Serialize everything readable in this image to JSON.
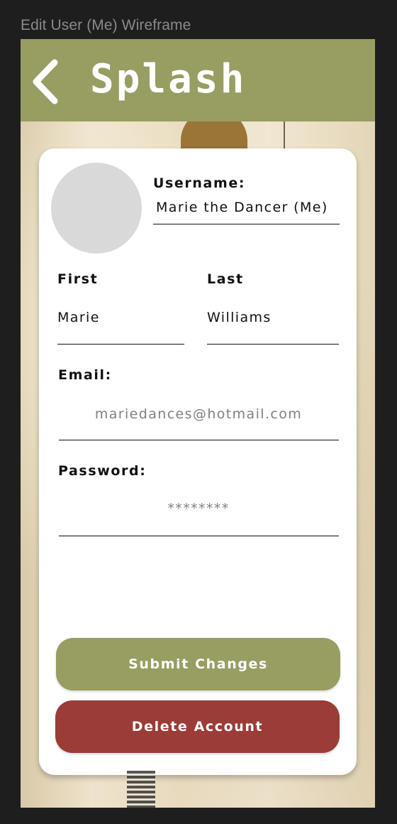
{
  "frame_label": "Edit User (Me) Wireframe",
  "header": {
    "title": "Splash",
    "back_icon": "chevron-left-icon",
    "background": "#989d62"
  },
  "profile": {
    "avatar": "avatar-placeholder",
    "username_label": "Username:",
    "username_value": "Marie the Dancer (Me)"
  },
  "form": {
    "first_label": "First",
    "first_value": "Marie",
    "last_label": "Last",
    "last_value": "Williams",
    "email_label": "Email:",
    "email_value": "mariedances@hotmail.com",
    "password_label": "Password:",
    "password_value": "********"
  },
  "actions": {
    "submit_label": "Submit Changes",
    "submit_color": "#989d62",
    "delete_label": "Delete Account",
    "delete_color": "#9b3c38"
  }
}
